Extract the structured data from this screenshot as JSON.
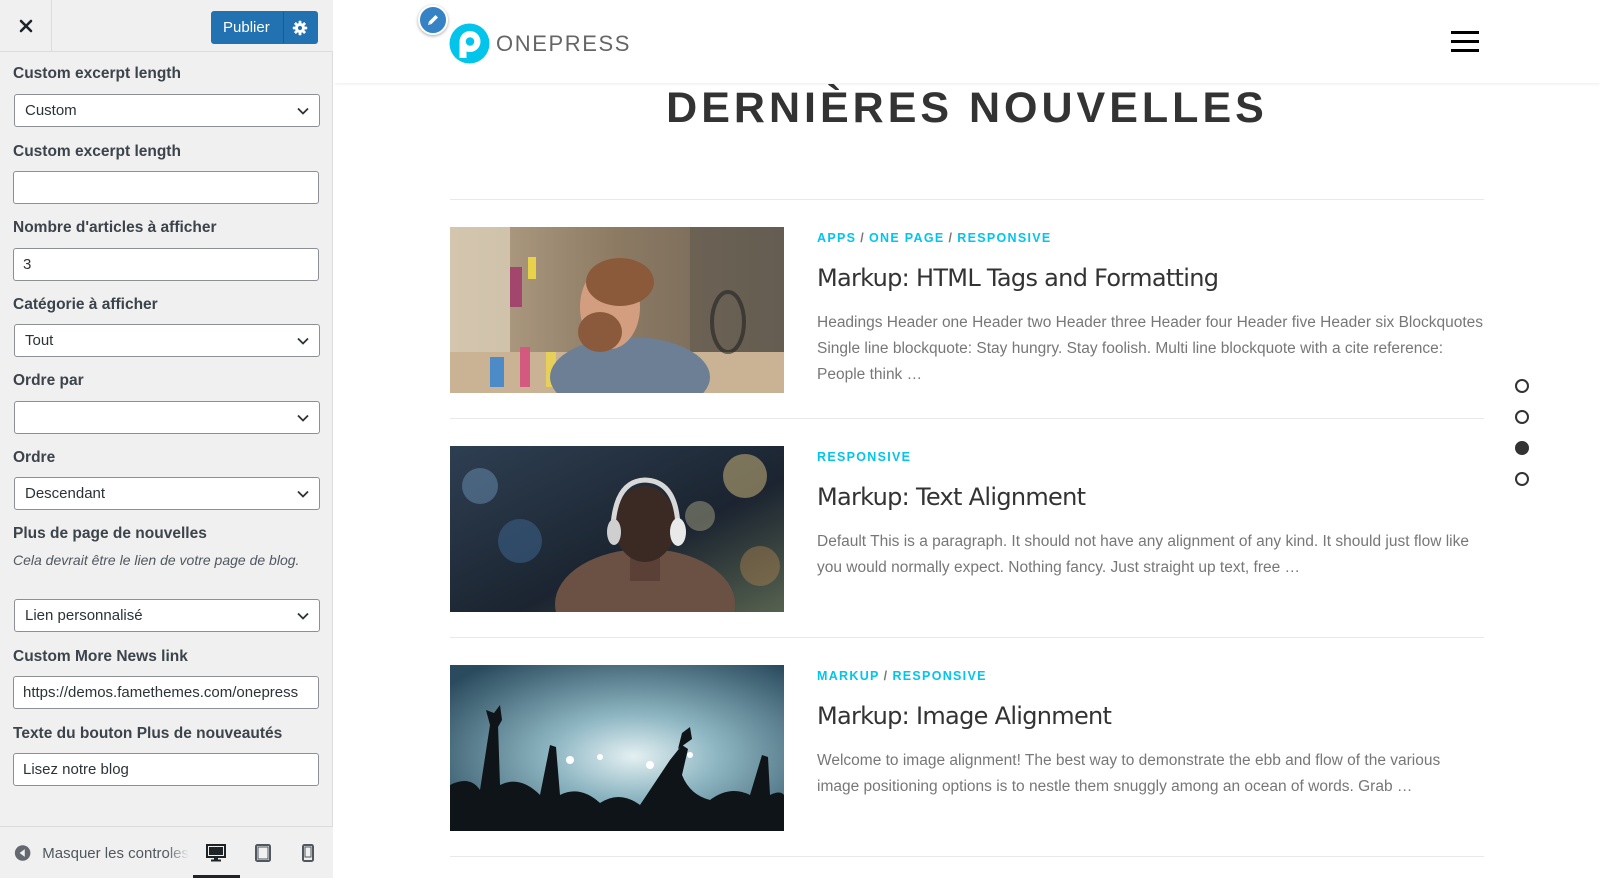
{
  "customizer": {
    "publish_label": "Publier",
    "fields": {
      "excerpt_type": {
        "label": "Custom excerpt length",
        "value": "Custom"
      },
      "excerpt_length": {
        "label": "Custom excerpt length",
        "value": ""
      },
      "posts_number": {
        "label": "Nombre d'articles à afficher",
        "value": "3"
      },
      "category": {
        "label": "Catégorie à afficher",
        "value": "Tout"
      },
      "orderby": {
        "label": "Ordre par",
        "value": ""
      },
      "order": {
        "label": "Ordre",
        "value": "Descendant"
      },
      "more_page": {
        "label": "Plus de page de nouvelles",
        "description": "Cela devrait être le lien de votre page de blog.",
        "value": "Lien personnalisé"
      },
      "more_link": {
        "label": "Custom More News link",
        "value": "https://demos.famethemes.com/onepress"
      },
      "more_text": {
        "label": "Texte du bouton Plus de nouveautés",
        "value": "Lisez notre blog"
      }
    },
    "footer": {
      "collapse_label": "Masquer les controles"
    }
  },
  "preview": {
    "logo_text": "ONEPRESS",
    "section_title": "DERNIÈRES NOUVELLES",
    "posts": [
      {
        "categories": [
          "APPS",
          "ONE PAGE",
          "RESPONSIVE"
        ],
        "title": "Markup: HTML Tags and Formatting",
        "excerpt": "Headings Header one Header two Header three Header four Header five Header six Blockquotes Single line blockquote: Stay hungry. Stay foolish. Multi line blockquote with a cite reference: People think …",
        "image": "man-at-desk-photo"
      },
      {
        "categories": [
          "RESPONSIVE"
        ],
        "title": "Markup: Text Alignment",
        "excerpt": "Default This is a paragraph. It should not have any alignment of any kind. It should just flow like you would normally expect. Nothing fancy. Just straight up text, free …",
        "image": "headphones-concert-photo"
      },
      {
        "categories": [
          "MARKUP",
          "RESPONSIVE"
        ],
        "title": "Markup: Image Alignment",
        "excerpt": "Welcome to image alignment! The best way to demonstrate the ebb and flow of the various image positioning options is to nestle them snuggly among an ocean of words. Grab …",
        "image": "concert-crowd-photo"
      }
    ],
    "section_nav": {
      "count": 4,
      "active_index": 2
    }
  },
  "colors": {
    "accent": "#03c4eb",
    "wp_blue": "#2271b1",
    "title": "#333333",
    "excerpt": "#777777"
  }
}
